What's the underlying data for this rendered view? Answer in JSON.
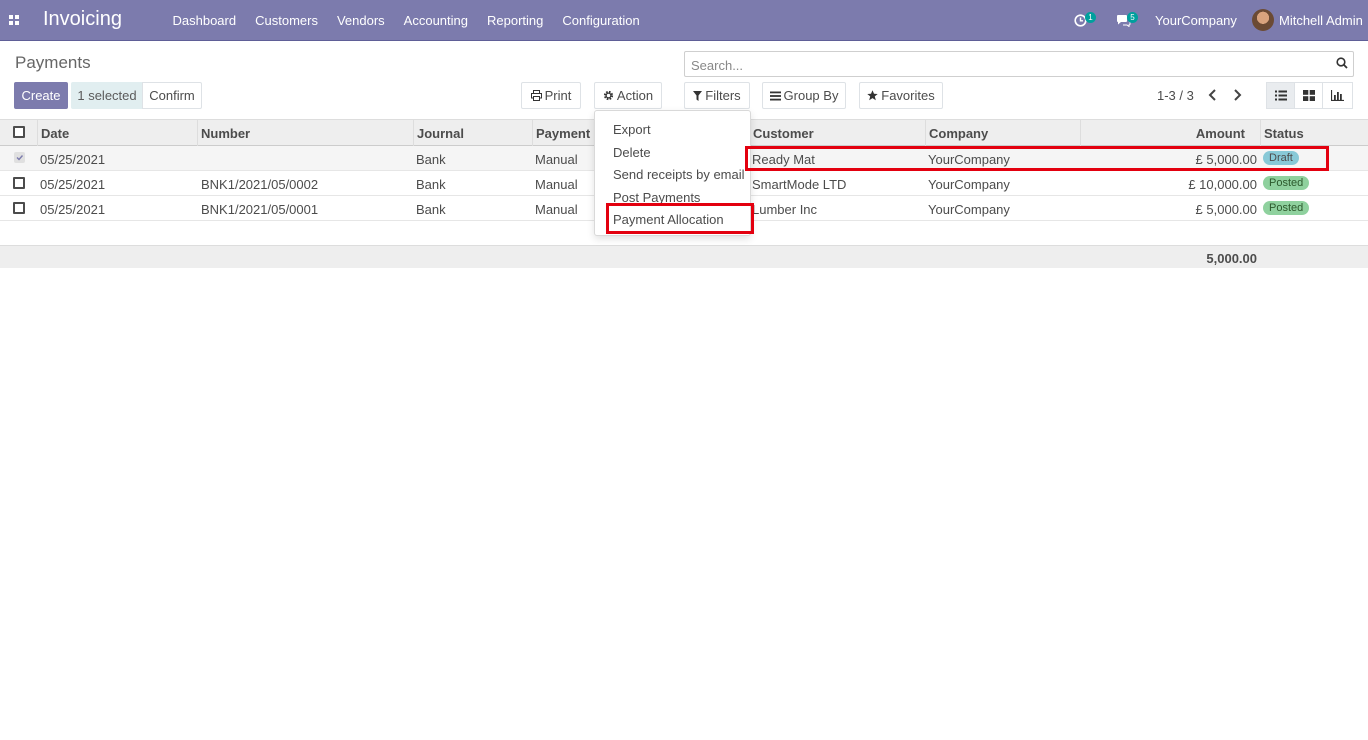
{
  "navbar": {
    "app_title": "Invoicing",
    "menu": [
      "Dashboard",
      "Customers",
      "Vendors",
      "Accounting",
      "Reporting",
      "Configuration"
    ],
    "activity_count": "1",
    "message_count": "5",
    "company": "YourCompany",
    "user": "Mitchell Admin"
  },
  "page": {
    "title": "Payments",
    "search_placeholder": "Search...",
    "buttons": {
      "create": "Create",
      "selected": "1 selected",
      "confirm": "Confirm",
      "print": "Print",
      "action": "Action",
      "filters": "Filters",
      "group_by": "Group By",
      "favorites": "Favorites"
    },
    "pager": "1-3 / 3"
  },
  "table": {
    "headers": [
      "Date",
      "Number",
      "Journal",
      "Payment M",
      "Customer",
      "Company",
      "Amount",
      "Status"
    ],
    "rows": [
      {
        "date": "05/25/2021",
        "number": "",
        "journal": "Bank",
        "method": "Manual",
        "customer": "Ready Mat",
        "company": "YourCompany",
        "amount": "£ 5,000.00",
        "status": "Draft",
        "selected": true
      },
      {
        "date": "05/25/2021",
        "number": "BNK1/2021/05/0002",
        "journal": "Bank",
        "method": "Manual",
        "customer": "SmartMode LTD",
        "company": "YourCompany",
        "amount": "£ 10,000.00",
        "status": "Posted",
        "selected": false
      },
      {
        "date": "05/25/2021",
        "number": "BNK1/2021/05/0001",
        "journal": "Bank",
        "method": "Manual",
        "customer": "Lumber Inc",
        "company": "YourCompany",
        "amount": "£ 5,000.00",
        "status": "Posted",
        "selected": false
      }
    ],
    "total": "5,000.00"
  },
  "action_menu": [
    "Export",
    "Delete",
    "Send receipts by email",
    "Post Payments",
    "Payment Allocation"
  ],
  "colors": {
    "brand": "#7c7bad",
    "highlight": "#e3000f",
    "draft": "#88c9d7",
    "posted": "#8fd19e"
  }
}
